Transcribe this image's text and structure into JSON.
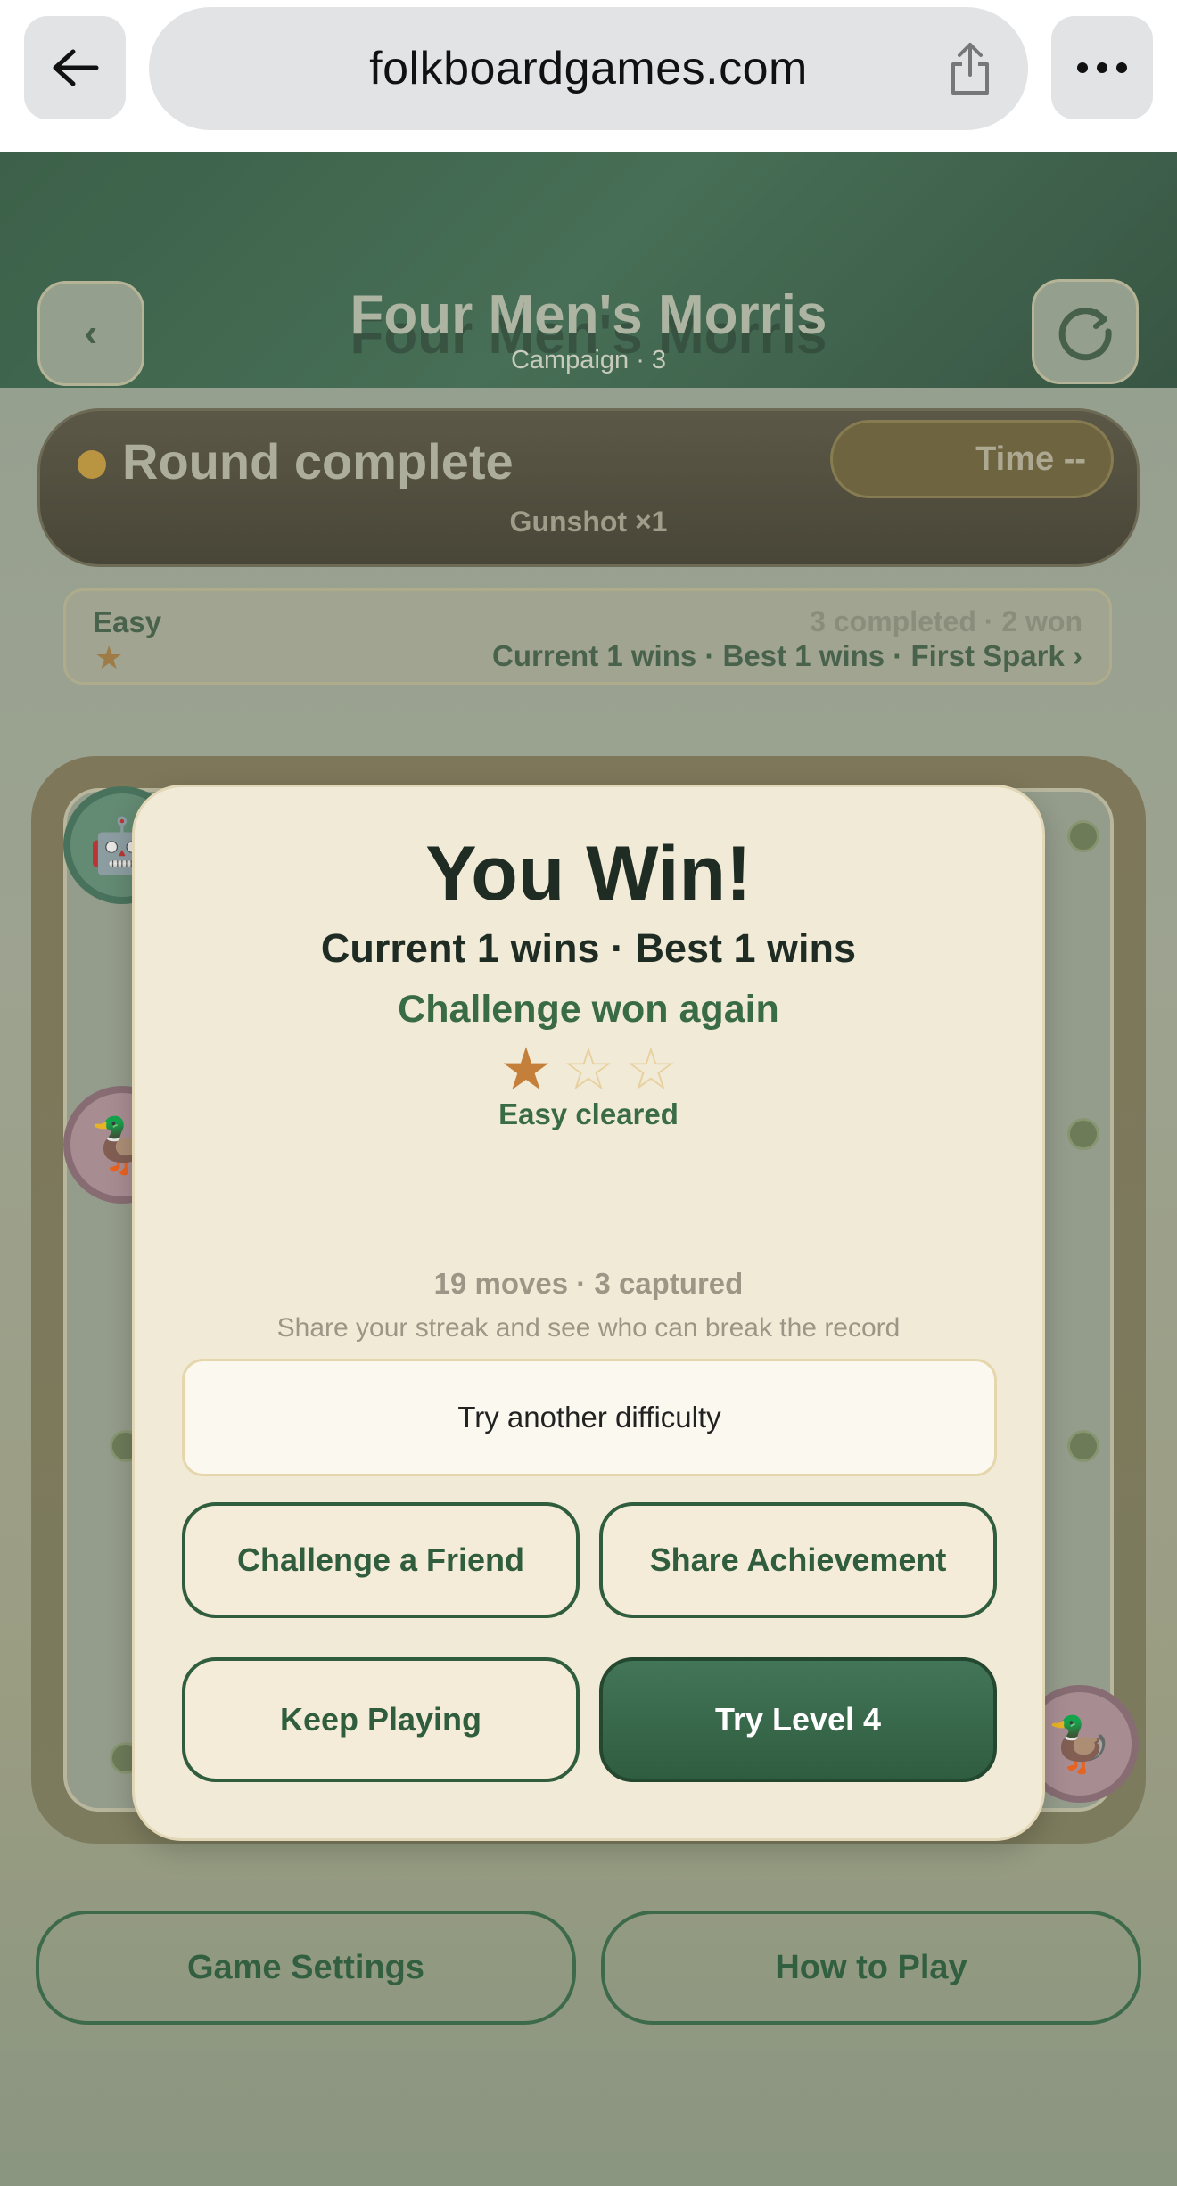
{
  "browser": {
    "url": "folkboardgames.com",
    "back_icon": "arrow-left-icon",
    "share_icon": "share-icon",
    "more_icon": "more-horizontal-icon"
  },
  "header": {
    "title": "Four Men's Morris",
    "subtitle": "Campaign · 3",
    "back_label": "‹",
    "restart_icon": "restart-icon"
  },
  "status": {
    "title": "Round complete",
    "time": "Time --",
    "subtitle": "Gunshot ×1",
    "dot_color": "#c79a38"
  },
  "difficulty": {
    "label": "Easy",
    "star": "★",
    "summary": "3 completed · 2 won",
    "streak": "Current 1 wins · Best 1 wins · First Spark  ›"
  },
  "board": {
    "pieces": [
      {
        "type": "robot",
        "icon": "robot-icon",
        "glyph": "🤖"
      },
      {
        "type": "duck",
        "icon": "duck-icon",
        "glyph": "🦆"
      },
      {
        "type": "duck",
        "icon": "duck-icon",
        "glyph": "🦆"
      }
    ]
  },
  "modal": {
    "title": "You Win!",
    "streak": "Current 1 wins · Best 1 wins",
    "challenge": "Challenge won again",
    "stars": {
      "filled": 1,
      "total": 3,
      "filled_glyph": "★",
      "empty_glyph": "☆"
    },
    "cleared": "Easy cleared",
    "stats": "19 moves · 3 captured",
    "share_hint": "Share your streak and see who can break the record",
    "try_difficulty": "Try another difficulty",
    "challenge_friend": "Challenge a Friend",
    "share_achievement": "Share Achievement",
    "keep_playing": "Keep Playing",
    "next_level": "Try Level 4"
  },
  "footer": {
    "settings": "Game Settings",
    "how_to_play": "How to Play"
  },
  "colors": {
    "accent_green": "#2f5d3d",
    "star_filled": "#c47f3a",
    "modal_bg": "#f1ead7"
  }
}
